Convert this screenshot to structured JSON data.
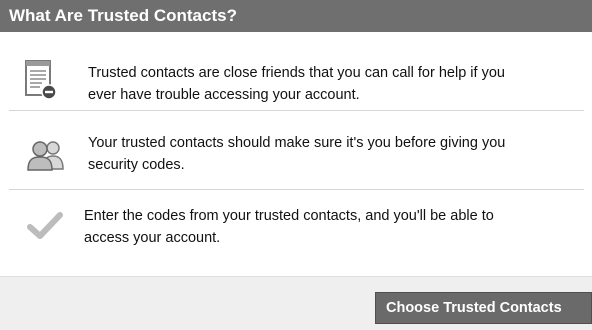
{
  "header": {
    "title": "What Are Trusted Contacts?"
  },
  "rows": [
    {
      "icon": "document-minus-icon",
      "lines": [
        "Trusted contacts are close friends that you can call for help if you",
        "ever have trouble accessing your account."
      ]
    },
    {
      "icon": "people-icon",
      "lines": [
        "Your trusted contacts should make sure it's you before giving you",
        "security codes."
      ]
    },
    {
      "icon": "checkmark-icon",
      "lines": [
        "Enter the codes from your trusted contacts, and you'll be able to",
        "access your account."
      ]
    }
  ],
  "footer": {
    "primary_button_label": "Choose Trusted Contacts"
  },
  "colors": {
    "header_bg": "#6f6f6f",
    "button_bg": "#6a6a6a",
    "footer_bg": "#efefef"
  }
}
